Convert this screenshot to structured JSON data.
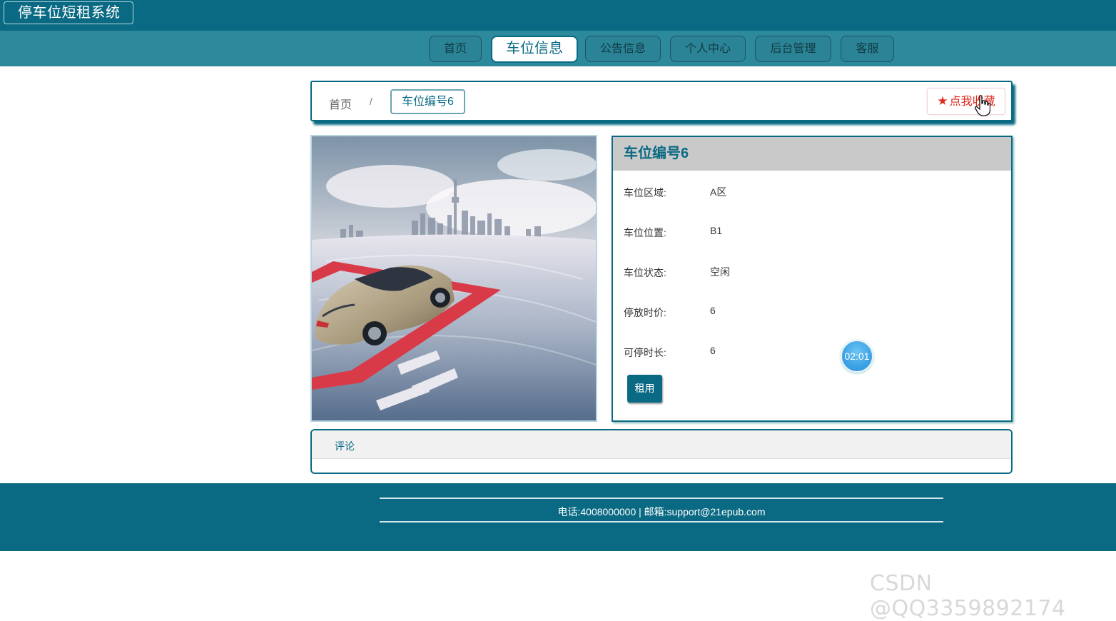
{
  "brand": "停车位短租系统",
  "nav": [
    {
      "label": "首页",
      "active": false
    },
    {
      "label": "车位信息",
      "active": true
    },
    {
      "label": "公告信息",
      "active": false
    },
    {
      "label": "个人中心",
      "active": false
    },
    {
      "label": "后台管理",
      "active": false
    },
    {
      "label": "客服",
      "active": false
    }
  ],
  "breadcrumb": {
    "home": "首页",
    "separator": "/",
    "current": "车位编号6"
  },
  "favorite_label": "点我收藏",
  "detail": {
    "title": "车位编号6",
    "fields": [
      {
        "label": "车位区域:",
        "value": "A区"
      },
      {
        "label": "车位位置:",
        "value": "B1"
      },
      {
        "label": "车位状态:",
        "value": "空闲"
      },
      {
        "label": "停放时价:",
        "value": "6"
      },
      {
        "label": "可停时长:",
        "value": "6"
      }
    ],
    "rent_label": "租用"
  },
  "timer": "02:01",
  "comments_label": "评论",
  "footer_text": "电话:4008000000 | 邮箱:support@21epub.com",
  "watermark": "CSDN @QQ3359892174",
  "colors": {
    "primary": "#0a6a83",
    "nav_bg": "#2d8a9c",
    "favorite": "#e0281c"
  },
  "icons": {
    "favorite": "star-icon",
    "cursor": "hand-pointer-icon"
  }
}
